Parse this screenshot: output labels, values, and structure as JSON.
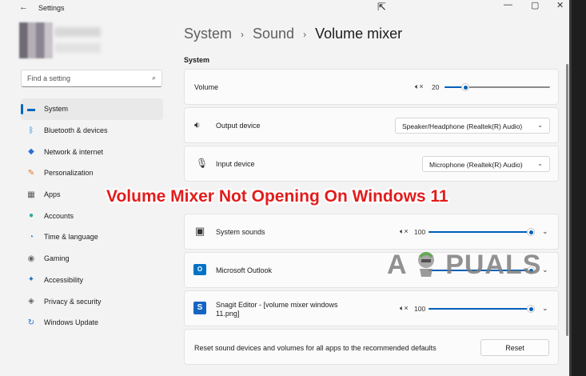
{
  "window": {
    "title": "Settings",
    "controls": {
      "minimize": "—",
      "maximize": "▢",
      "close": "✕"
    }
  },
  "search": {
    "placeholder": "Find a setting"
  },
  "nav": [
    {
      "label": "System",
      "icon": "monitor-icon",
      "active": true
    },
    {
      "label": "Bluetooth & devices",
      "icon": "bluetooth-icon"
    },
    {
      "label": "Network & internet",
      "icon": "wifi-icon"
    },
    {
      "label": "Personalization",
      "icon": "brush-icon"
    },
    {
      "label": "Apps",
      "icon": "apps-icon"
    },
    {
      "label": "Accounts",
      "icon": "person-icon"
    },
    {
      "label": "Time & language",
      "icon": "globe-clock-icon"
    },
    {
      "label": "Gaming",
      "icon": "gamepad-icon"
    },
    {
      "label": "Accessibility",
      "icon": "accessibility-icon"
    },
    {
      "label": "Privacy & security",
      "icon": "shield-icon"
    },
    {
      "label": "Windows Update",
      "icon": "update-icon"
    }
  ],
  "breadcrumb": {
    "level1": "System",
    "level2": "Sound",
    "current": "Volume mixer"
  },
  "system_section": {
    "heading": "System",
    "volume": {
      "label": "Volume",
      "value": "20",
      "level": 0.2
    },
    "output": {
      "label": "Output device",
      "selected": "Speaker/Headphone (Realtek(R) Audio)"
    },
    "input": {
      "label": "Input device",
      "selected": "Microphone (Realtek(R) Audio)"
    }
  },
  "apps": [
    {
      "name": "System sounds",
      "icon": "speaker-icon",
      "value": "100",
      "level": 1.0
    },
    {
      "name": "Microsoft Outlook",
      "icon": "outlook-icon",
      "value": "100",
      "level": 1.0
    },
    {
      "name": "Snagit Editor - [volume mixer windows 11.png]",
      "icon": "snagit-icon",
      "value": "100",
      "level": 1.0
    }
  ],
  "reset": {
    "text": "Reset sound devices and volumes for all apps to the recommended defaults",
    "button": "Reset"
  },
  "overlay": {
    "banner": "Volume Mixer Not Opening On Windows 11",
    "watermark_left": "A",
    "watermark_right": "PUALS"
  },
  "colors": {
    "accent": "#005fb8",
    "banner": "#e21c1c"
  }
}
